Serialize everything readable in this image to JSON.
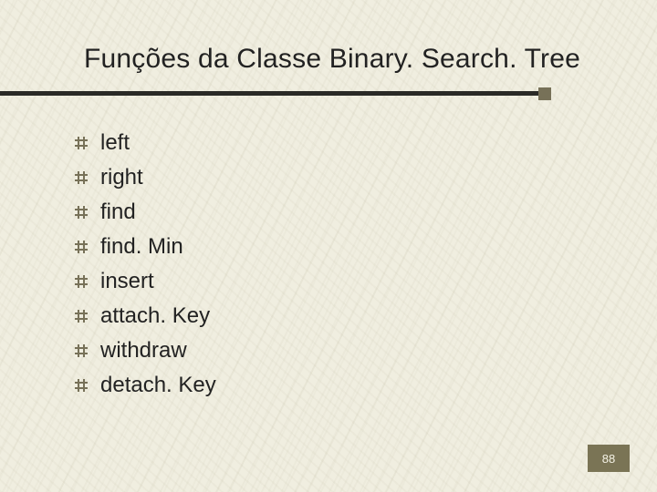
{
  "title": "Funções da Classe Binary. Search. Tree",
  "items": [
    {
      "label": "left"
    },
    {
      "label": "right"
    },
    {
      "label": "find"
    },
    {
      "label": "find. Min"
    },
    {
      "label": "insert"
    },
    {
      "label": "attach. Key"
    },
    {
      "label": "withdraw"
    },
    {
      "label": "detach. Key"
    }
  ],
  "page_number": "88",
  "colors": {
    "accent": "#7a7455",
    "rule": "#2a2a26",
    "bg": "#f0eee0"
  }
}
